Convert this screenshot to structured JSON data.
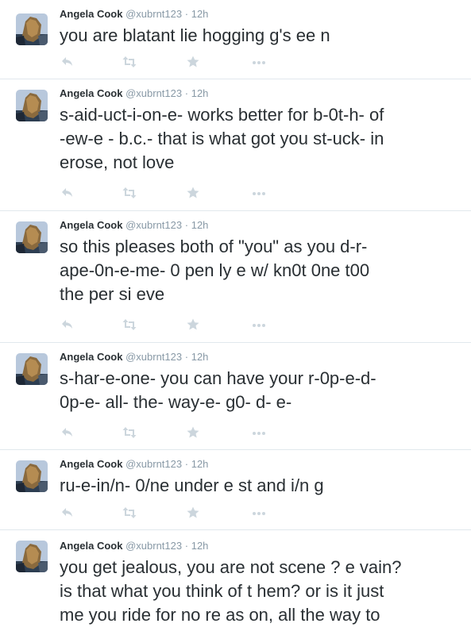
{
  "tweets": [
    {
      "name": "Angela Cook",
      "handle": "@xubrnt123",
      "dot": "·",
      "time": "12h",
      "text": "you are blatant lie hogging g's ee n"
    },
    {
      "name": "Angela Cook",
      "handle": "@xubrnt123",
      "dot": "·",
      "time": "12h",
      "text": "s-aid-uct-i-on-e- works better for b-0t-h- of\n-ew-e - b.c.- that is what got you st-uck- in\nerose, not love"
    },
    {
      "name": "Angela Cook",
      "handle": "@xubrnt123",
      "dot": "·",
      "time": "12h",
      "text": "so this pleases both of \"you\" as you d-r-\nape-0n-e-me- 0 pen ly e w/ kn0t 0ne t00\nthe per si eve"
    },
    {
      "name": "Angela Cook",
      "handle": "@xubrnt123",
      "dot": "·",
      "time": "12h",
      "text": "s-har-e-one- you can have your r-0p-e-d-\n0p-e- all- the- way-e- g0- d- e-"
    },
    {
      "name": "Angela Cook",
      "handle": "@xubrnt123",
      "dot": "·",
      "time": "12h",
      "text": "ru-e-in/n- 0/ne under e st and i/n g"
    },
    {
      "name": "Angela Cook",
      "handle": "@xubrnt123",
      "dot": "·",
      "time": "12h",
      "text": "you get jealous, you are not scene ? e vain?\nis that what you think of t hem? or is it just\nme you ride for no re as on, all the way to"
    }
  ],
  "icons": {
    "reply": "reply-icon",
    "retweet": "retweet-icon",
    "favorite": "star-icon",
    "more": "more-icon"
  },
  "colors": {
    "text": "#292f33",
    "meta": "#8899a6",
    "action_icons": "#ccd6dd",
    "divider": "#e1e8ed"
  }
}
